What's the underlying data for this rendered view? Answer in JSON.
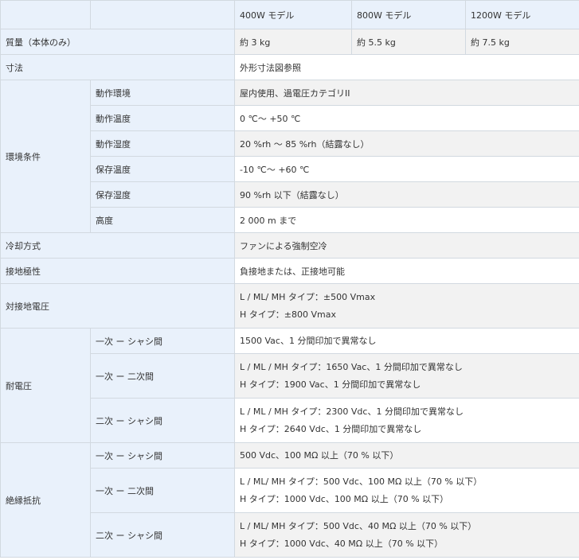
{
  "header": [
    "",
    "",
    "400W モデル",
    "800W モデル",
    "1200W モデル"
  ],
  "mass": {
    "label": "質量（本体のみ）",
    "values": [
      "約 3 kg",
      "約 5.5 kg",
      "約 7.5 kg"
    ]
  },
  "dimensions": {
    "label": "寸法",
    "value": "外形寸法図参照"
  },
  "environment": {
    "label": "環境条件",
    "rows": [
      {
        "label": "動作環境",
        "value": "屋内使用、過電圧カテゴリII"
      },
      {
        "label": "動作温度",
        "value": "0 ℃～ +50 ℃"
      },
      {
        "label": "動作湿度",
        "value": "20 %rh ～ 85 %rh（結露なし）"
      },
      {
        "label": "保存温度",
        "value": "-10 ℃～ +60 ℃"
      },
      {
        "label": "保存湿度",
        "value": "90 %rh 以下（結露なし）"
      },
      {
        "label": "高度",
        "value": "2 000 m まで"
      }
    ]
  },
  "cooling": {
    "label": "冷却方式",
    "value": "ファンによる強制空冷"
  },
  "grounding": {
    "label": "接地極性",
    "value": "負接地または、正接地可能"
  },
  "ground_voltage": {
    "label": "対接地電圧",
    "lines": [
      "L / ML/ MH タイプ：±500 Vmax",
      "H タイプ：±800 Vmax"
    ]
  },
  "withstand": {
    "label": "耐電圧",
    "rows": [
      {
        "label": "一次 ー シャシ間",
        "lines": [
          "1500 Vac、1 分間印加で異常なし"
        ]
      },
      {
        "label": "一次 ー 二次間",
        "lines": [
          "L / ML / MH タイプ：1650 Vac、1 分間印加で異常なし",
          "H タイプ：1900 Vac、1 分間印加で異常なし"
        ]
      },
      {
        "label": "二次 ー シャシ間",
        "lines": [
          "L / ML / MH タイプ：2300 Vdc、1 分間印加で異常なし",
          "H タイプ：2640 Vdc、1 分間印加で異常なし"
        ]
      }
    ]
  },
  "insulation": {
    "label": "絶縁抵抗",
    "rows": [
      {
        "label": "一次 ー シャシ間",
        "lines": [
          "500 Vdc、100 MΩ 以上（70 % 以下）"
        ]
      },
      {
        "label": "一次 ー 二次間",
        "lines": [
          "L / ML/ MH タイプ：500 Vdc、100 MΩ 以上（70 % 以下）",
          "H タイプ：1000 Vdc、100 MΩ 以上（70 % 以下）"
        ]
      },
      {
        "label": "二次 ー シャシ間",
        "lines": [
          "L / ML/ MH タイプ：500 Vdc、40 MΩ 以上（70 % 以下）",
          "H タイプ：1000 Vdc、40 MΩ 以上（70 % 以下）"
        ]
      }
    ]
  }
}
